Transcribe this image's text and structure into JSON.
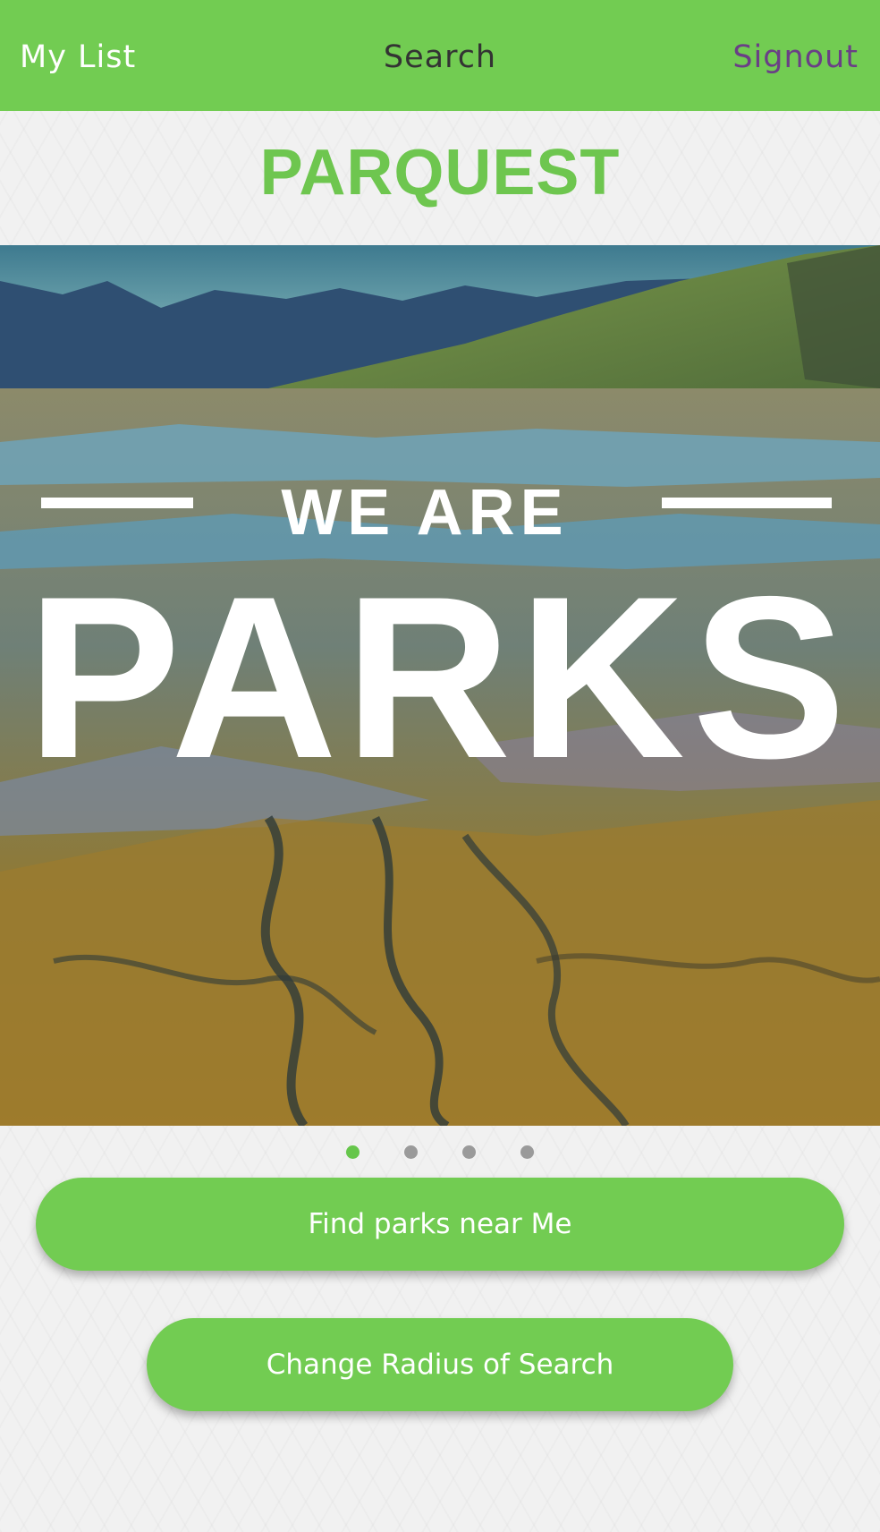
{
  "nav": {
    "left_label": "My List",
    "title": "Search",
    "right_label": "Signout"
  },
  "brand": {
    "title": "PARQUEST"
  },
  "hero": {
    "image_text_top": "WE ARE",
    "image_text_main": "PARKS"
  },
  "carousel": {
    "page_count": 4,
    "active_index": 0
  },
  "actions": {
    "find_label": "Find parks near Me",
    "radius_label": "Change Radius of Search"
  },
  "colors": {
    "accent": "#72cc52",
    "brand_text": "#6ec64f",
    "signout": "#6a3f86",
    "nav_title": "#333333"
  }
}
